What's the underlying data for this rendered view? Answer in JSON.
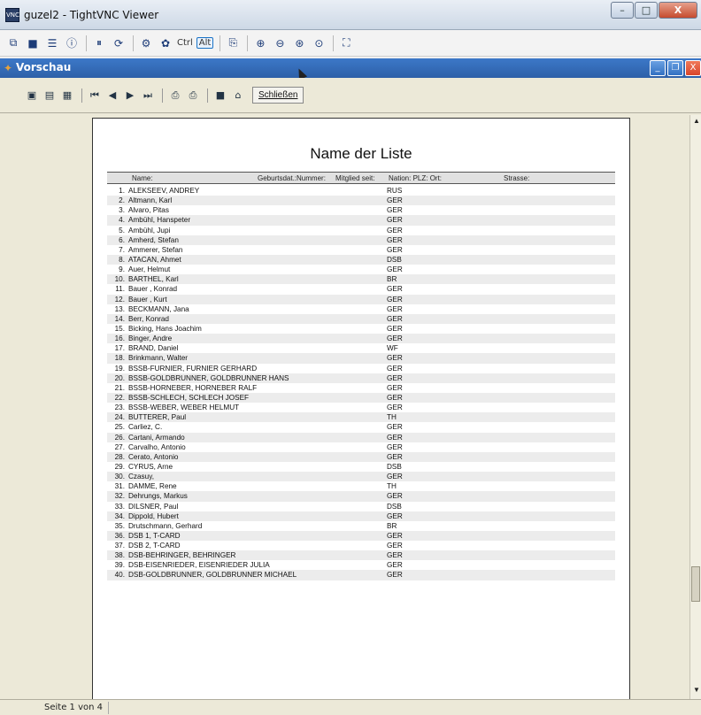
{
  "vnc": {
    "logo_text": "VNC",
    "title": "guzel2 - TightVNC Viewer",
    "buttons": {
      "minimize": "–",
      "maximize": "□",
      "close": "X"
    },
    "toolbar": {
      "ctrl_label": "Ctrl",
      "alt_label": "Alt"
    }
  },
  "app": {
    "title": "Vorschau",
    "buttons": {
      "minimize": "_",
      "restore": "❐",
      "close": "X"
    },
    "toolbar": {
      "close_label": "Schließen"
    }
  },
  "report": {
    "title": "Name der Liste",
    "columns": {
      "name": "Name:",
      "birthdate_number": "Geburtsdat.:Nummer:",
      "member_since": "Mitglied seit:",
      "nation_plz_ort": "Nation: PLZ: Ort:",
      "street": "Strasse:"
    },
    "rows": [
      {
        "num": "1.",
        "name": "ALEKSEEV, ANDREY",
        "nation": "RUS"
      },
      {
        "num": "2.",
        "name": "Altmann, Karl",
        "nation": "GER"
      },
      {
        "num": "3.",
        "name": "Alvaro, Pitas",
        "nation": "GER"
      },
      {
        "num": "4.",
        "name": "Ambühl, Hanspeter",
        "nation": "GER"
      },
      {
        "num": "5.",
        "name": "Ambühl, Jupi",
        "nation": "GER"
      },
      {
        "num": "6.",
        "name": "Amherd, Stefan",
        "nation": "GER"
      },
      {
        "num": "7.",
        "name": "Ammerer, Stefan",
        "nation": "GER"
      },
      {
        "num": "8.",
        "name": "ATACAN, Ahmet",
        "nation": "DSB"
      },
      {
        "num": "9.",
        "name": "Auer, Helmut",
        "nation": "GER"
      },
      {
        "num": "10.",
        "name": "BARTHEL, Karl",
        "nation": "BR"
      },
      {
        "num": "11.",
        "name": "Bauer , Konrad",
        "nation": "GER"
      },
      {
        "num": "12.",
        "name": "Bauer , Kurt",
        "nation": "GER"
      },
      {
        "num": "13.",
        "name": "BECKMANN, Jana",
        "nation": "GER"
      },
      {
        "num": "14.",
        "name": "Berr, Konrad",
        "nation": "GER"
      },
      {
        "num": "15.",
        "name": "Bicking, Hans Joachim",
        "nation": "GER"
      },
      {
        "num": "16.",
        "name": "Binger, Andre",
        "nation": "GER"
      },
      {
        "num": "17.",
        "name": "BRAND, Daniel",
        "nation": "WF"
      },
      {
        "num": "18.",
        "name": "Brinkmann, Walter",
        "nation": "GER"
      },
      {
        "num": "19.",
        "name": "BSSB-FURNIER, FURNIER GERHARD",
        "nation": "GER"
      },
      {
        "num": "20.",
        "name": "BSSB-GOLDBRUNNER, GOLDBRUNNER HANS",
        "nation": "GER"
      },
      {
        "num": "21.",
        "name": "BSSB-HORNEBER, HORNEBER RALF",
        "nation": "GER"
      },
      {
        "num": "22.",
        "name": "BSSB-SCHLECH, SCHLECH JOSEF",
        "nation": "GER"
      },
      {
        "num": "23.",
        "name": "BSSB-WEBER, WEBER HELMUT",
        "nation": "GER"
      },
      {
        "num": "24.",
        "name": "BUTTERER, Paul",
        "nation": "TH"
      },
      {
        "num": "25.",
        "name": "Carliez, C.",
        "nation": "GER"
      },
      {
        "num": "26.",
        "name": "Cartani, Armando",
        "nation": "GER"
      },
      {
        "num": "27.",
        "name": "Carvalho, Antonio",
        "nation": "GER"
      },
      {
        "num": "28.",
        "name": "Cerato, Antonio",
        "nation": "GER"
      },
      {
        "num": "29.",
        "name": "CYRUS, Arne",
        "nation": "DSB"
      },
      {
        "num": "30.",
        "name": "Czasuy,",
        "nation": "GER"
      },
      {
        "num": "31.",
        "name": "DAMME, Rene",
        "nation": "TH"
      },
      {
        "num": "32.",
        "name": "Dehrungs, Markus",
        "nation": "GER"
      },
      {
        "num": "33.",
        "name": "DILSNER, Paul",
        "nation": "DSB"
      },
      {
        "num": "34.",
        "name": "Dippold, Hubert",
        "nation": "GER"
      },
      {
        "num": "35.",
        "name": "Drutschmann, Gerhard",
        "nation": "BR"
      },
      {
        "num": "36.",
        "name": "DSB 1, T-CARD",
        "nation": "GER"
      },
      {
        "num": "37.",
        "name": "DSB 2, T-CARD",
        "nation": "GER"
      },
      {
        "num": "38.",
        "name": "DSB-BEHRINGER, BEHRINGER",
        "nation": "GER"
      },
      {
        "num": "39.",
        "name": "DSB-EISENRIEDER, EISENRIEDER JULIA",
        "nation": "GER"
      },
      {
        "num": "40.",
        "name": "DSB-GOLDBRUNNER, GOLDBRUNNER MICHAEL",
        "nation": "GER"
      }
    ]
  },
  "status": {
    "page": "Seite 1 von 4"
  }
}
